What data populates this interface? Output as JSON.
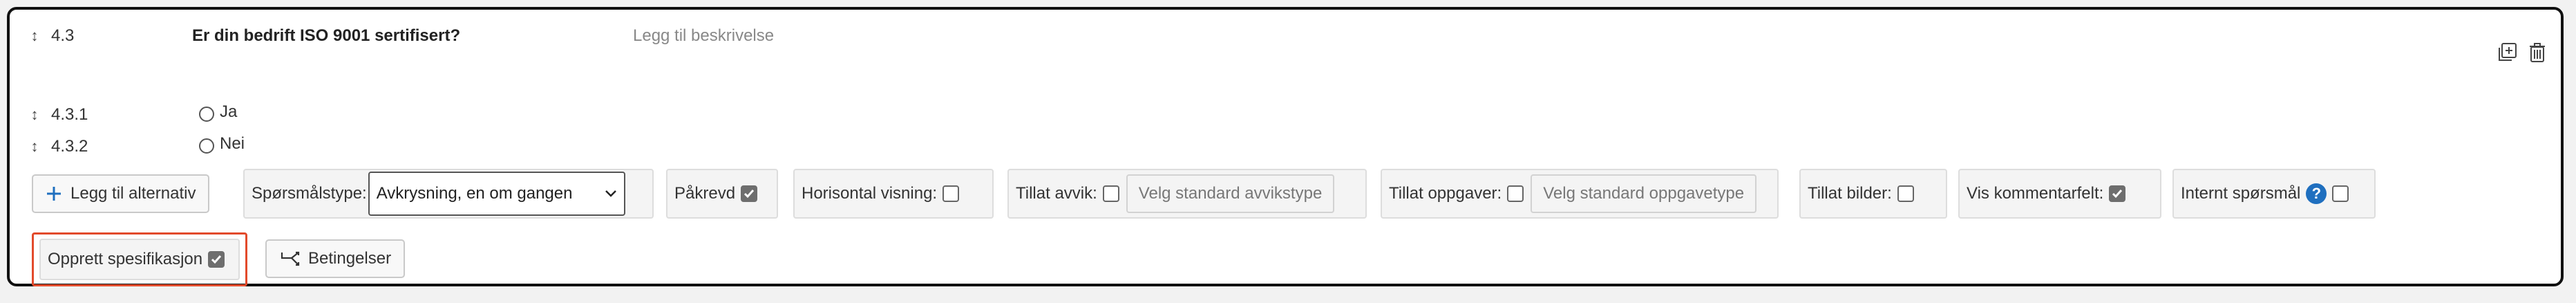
{
  "question": {
    "number": "4.3",
    "title": "Er din bedrift ISO 9001 sertifisert?",
    "description_placeholder": "Legg til beskrivelse",
    "actions": {
      "add_icon": "add-copy-icon",
      "delete_icon": "trash-icon"
    }
  },
  "options": [
    {
      "number": "4.3.1",
      "label": "Ja"
    },
    {
      "number": "4.3.2",
      "label": "Nei"
    }
  ],
  "toolbar": {
    "add_option_label": "Legg til alternativ",
    "question_type_label": "Spørsmålstype:",
    "question_type_value": "Avkrysning, en om gangen",
    "required_label": "Påkrevd",
    "required_checked": true,
    "horizontal_label": "Horisontal visning:",
    "horizontal_checked": false,
    "deviation_label": "Tillat avvik:",
    "deviation_checked": false,
    "deviation_placeholder": "Velg standard avvikstype",
    "tasks_label": "Tillat oppgaver:",
    "tasks_checked": false,
    "tasks_placeholder": "Velg standard oppgavetype",
    "images_label": "Tillat bilder:",
    "images_checked": false,
    "comment_label": "Vis kommentarfelt:",
    "comment_checked": true,
    "internal_label": "Internt spørsmål",
    "internal_checked": false
  },
  "bottom": {
    "spec_label": "Opprett spesifikasjon",
    "spec_checked": true,
    "conditions_label": "Betingelser"
  },
  "colors": {
    "highlight": "#e24a2b",
    "help": "#1f6fbf",
    "add_plus": "#1f6fbf"
  }
}
